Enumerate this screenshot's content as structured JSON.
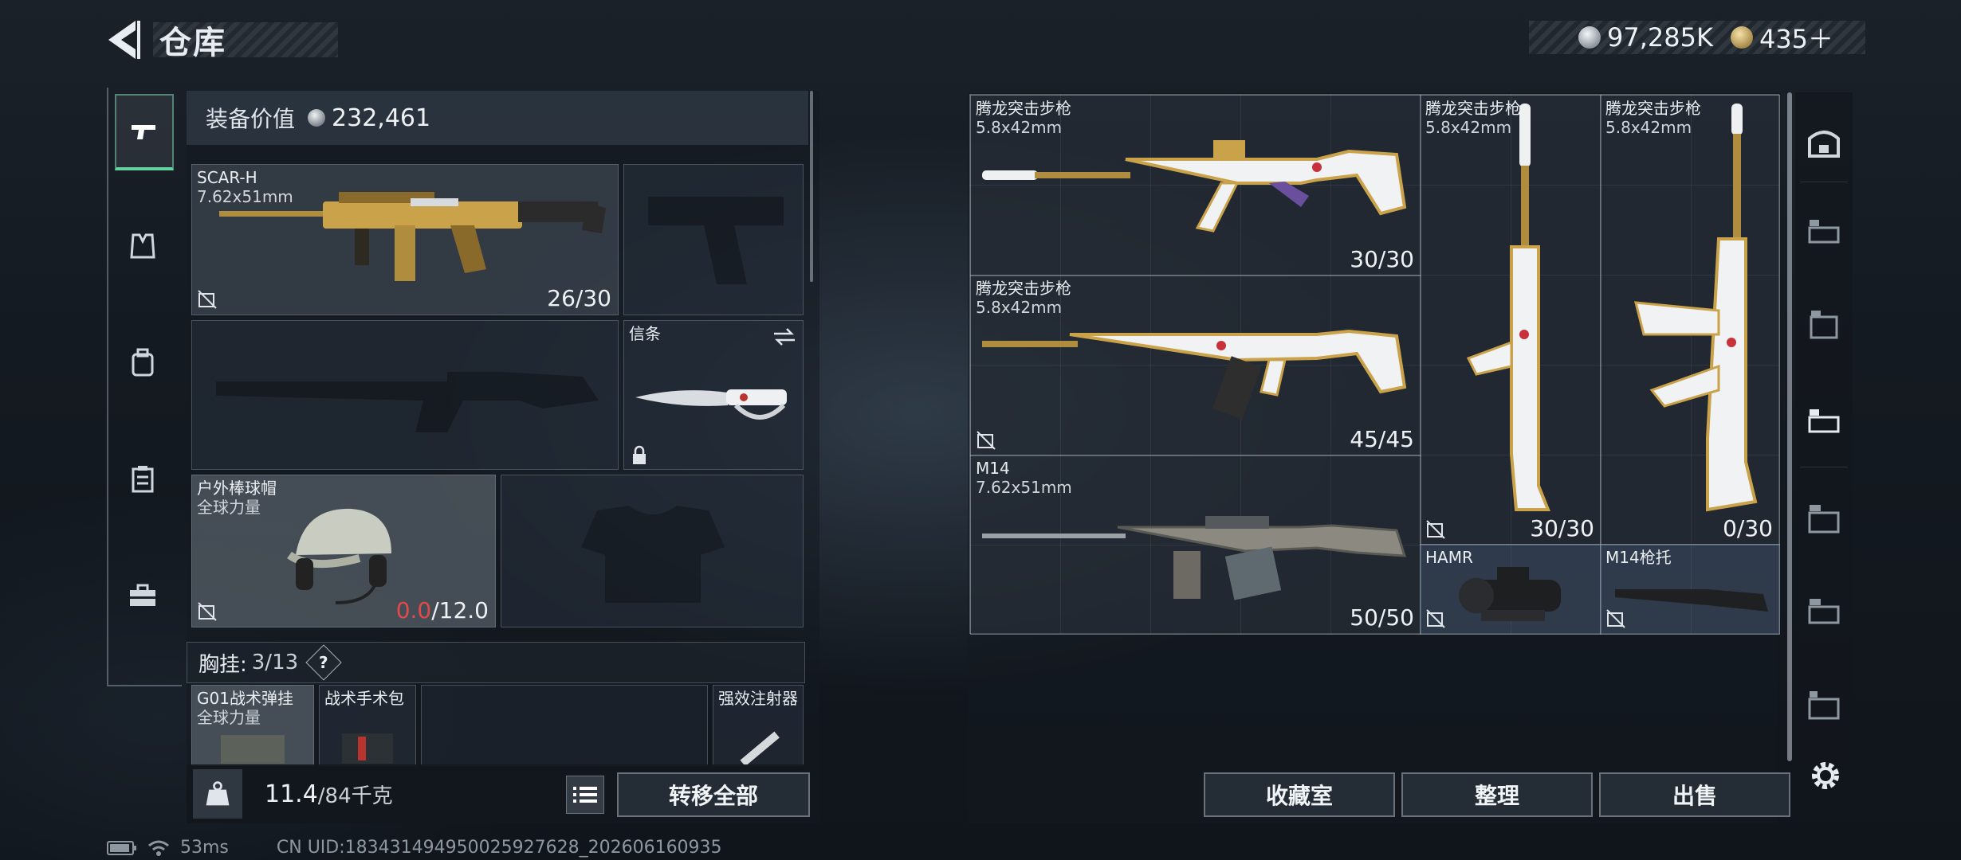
{
  "header": {
    "title": "仓库",
    "currency_silver": "97,285K",
    "currency_gold": "435＋"
  },
  "left_nav": {
    "items": [
      {
        "icon": "pistol-icon",
        "active": true
      },
      {
        "icon": "vest-icon",
        "active": false
      },
      {
        "icon": "backpack-icon",
        "active": false
      },
      {
        "icon": "clipboard-icon",
        "active": false
      },
      {
        "icon": "toolbox-icon",
        "active": false
      }
    ]
  },
  "equipment": {
    "label": "装备价值",
    "value": "232,461",
    "primary": {
      "name": "SCAR-H",
      "caliber": "7.62x51mm",
      "count": "26/30"
    },
    "knife_slot": {
      "label": "信条"
    },
    "helmet": {
      "name": "户外棒球帽",
      "sub": "全球力量",
      "durability_current": "0.0",
      "durability_max": "/12.0"
    },
    "chest_rig": {
      "label": "胸挂:",
      "count": "3/13",
      "help": "?"
    },
    "rig_items": [
      {
        "name": "G01战术弹挂",
        "sub": "全球力量"
      },
      {
        "name": "战术手术包"
      },
      {
        "name": "强效注射器"
      }
    ],
    "weight": {
      "current": "11.4",
      "total": "/84千克"
    },
    "transfer_all": "转移全部"
  },
  "storage": {
    "items": [
      {
        "name": "腾龙突击步枪",
        "caliber": "5.8x42mm",
        "count": "30/30"
      },
      {
        "name": "腾龙突击步枪",
        "caliber": "5.8x42mm",
        "count": "45/45"
      },
      {
        "name": "M14",
        "caliber": "7.62x51mm",
        "count": "50/50"
      },
      {
        "name": "腾龙突击步枪",
        "caliber": "5.8x42mm",
        "count": "30/30"
      },
      {
        "name": "腾龙突击步枪",
        "caliber": "5.8x42mm",
        "count": "0/30"
      },
      {
        "name": "HAMR"
      },
      {
        "name": "M14枪托"
      }
    ],
    "buttons": {
      "collection": "收藏室",
      "organize": "整理",
      "sell": "出售"
    }
  },
  "footer": {
    "ping": "53ms",
    "uid": "CN UID:18343149495002592762​8_202606160935"
  },
  "colors": {
    "accent_green": "#63d3a2",
    "warn_red": "#e24a4a",
    "gold": "#c9a24a"
  }
}
